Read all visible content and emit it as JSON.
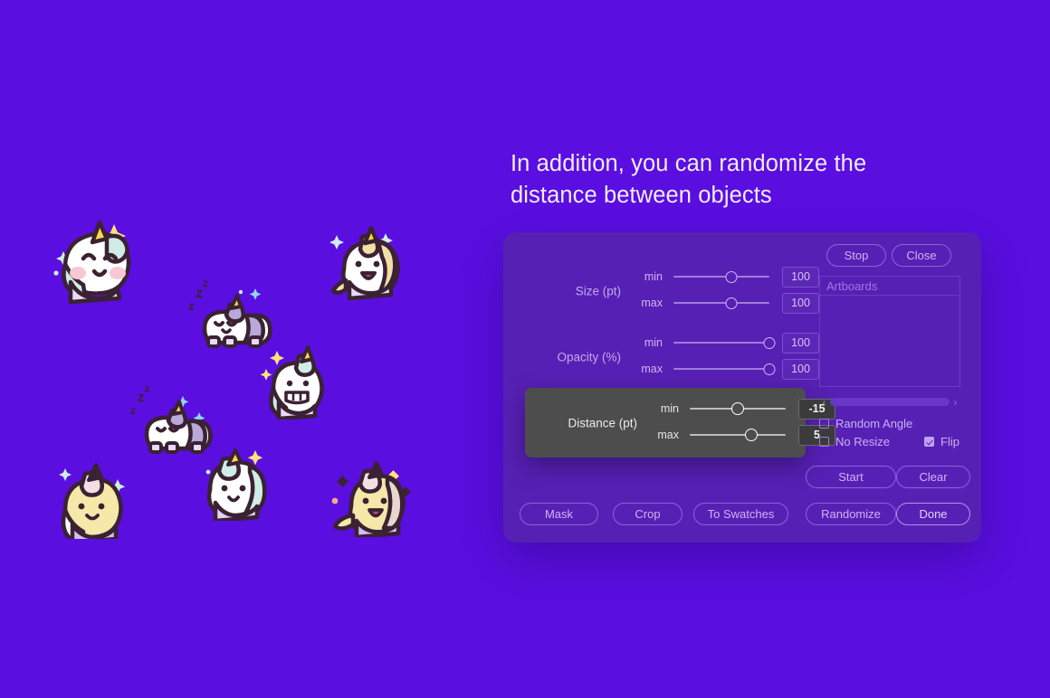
{
  "heading": {
    "line1": "In addition, you can randomize the",
    "line2": "distance between objects"
  },
  "panel": {
    "groups": [
      {
        "label": "Size (pt)",
        "rows": [
          {
            "minmax": "min",
            "value": "100",
            "knob_pct": 60
          },
          {
            "minmax": "max",
            "value": "100",
            "knob_pct": 60
          }
        ]
      },
      {
        "label": "Opacity (%)",
        "rows": [
          {
            "minmax": "min",
            "value": "100",
            "knob_pct": 100
          },
          {
            "minmax": "max",
            "value": "100",
            "knob_pct": 100
          }
        ]
      }
    ],
    "distance": {
      "label": "Distance (pt)",
      "rows": [
        {
          "minmax": "min",
          "value": "-15",
          "knob_pct": 50
        },
        {
          "minmax": "max",
          "value": "5",
          "knob_pct": 64
        }
      ]
    },
    "top_buttons": [
      {
        "label": "Stop"
      },
      {
        "label": "Close"
      }
    ],
    "artboards": {
      "header": "Artboards",
      "scroll_left_icon": "‹",
      "scroll_right_icon": "›"
    },
    "checkboxes": [
      {
        "label": "Random Angle",
        "checked": false
      },
      {
        "label": "No Resize",
        "checked": false
      },
      {
        "label": "Flip",
        "checked": true
      }
    ],
    "action_buttons": [
      {
        "label": "Start"
      },
      {
        "label": "Clear"
      }
    ],
    "bottom_buttons": [
      {
        "label": "Mask"
      },
      {
        "label": "Crop"
      },
      {
        "label": "To Swatches"
      },
      {
        "label": "Randomize"
      },
      {
        "label": "Done"
      }
    ]
  },
  "colors": {
    "background": "#5a0ee0",
    "panel": "#5720b4",
    "highlight_card": "#4d4d4d",
    "accent_text": "#cdb4f4",
    "heading_text": "#f2ecfb"
  },
  "illustrations": [
    {
      "name": "unicorn-happy-blush"
    },
    {
      "name": "unicorn-waving"
    },
    {
      "name": "unicorn-sleeping-top"
    },
    {
      "name": "unicorn-grinning"
    },
    {
      "name": "unicorn-sleeping-bottom"
    },
    {
      "name": "unicorn-yellow-shy"
    },
    {
      "name": "unicorn-smiling-white"
    },
    {
      "name": "unicorn-yellow-cheering"
    }
  ]
}
